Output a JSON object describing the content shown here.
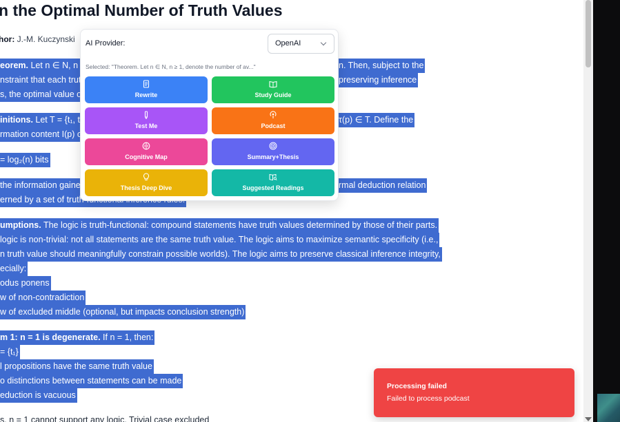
{
  "document": {
    "title": "n the Optimal Number of Truth Values",
    "author_label": "hor:",
    "author_name": "J.-M. Kuczynski",
    "lines": {
      "l1a": "eorem.",
      "l1b": " Let n ∈ N, n ≥ 1",
      "l1c": "n. Then, subject to the",
      "l2a": "nstraint that each truth",
      "l2b": "preserving inference",
      "l3a": "s, the optimal value of",
      "l4a": "initions.",
      "l4b": " Let T = {t₁, t₂,",
      "l4c": "τ(p) ∈ T. Define the",
      "l5a": "rmation content I(p) o",
      "l6": "= log₂(n) bits",
      "l7a": " the information gaine",
      "l7b": "rmal deduction relation",
      "l8": "erned by a set of truth-functional inference rules.",
      "l9a": "umptions.",
      "l9b": " The logic is truth-functional: compound statements have truth values determined by those of their parts.",
      "l10": " logic is non-trivial: not all statements are the same truth value. The logic aims to maximize semantic specificity (i.e.,",
      "l11": "n truth value should meaningfully constrain possible worlds). The logic aims to preserve classical inference integrity,",
      "l12": "ecially:",
      "l13": "odus ponens",
      "l14": "w of non-contradiction",
      "l15": "w of excluded middle (optional, but impacts conclusion strength)",
      "l16a": "m 1: n = 1 is degenerate.",
      "l16b": " If n = 1, then:",
      "l17": "= {t₁}",
      "l18": "l propositions have the same truth value",
      "l19": "o distinctions between statements can be made",
      "l20": "eduction is vacuous",
      "l21": "s. n = 1 cannot support any logic. Trivial case excluded"
    }
  },
  "popup": {
    "provider_label": "AI Provider:",
    "provider_value": "OpenAI",
    "selected_text": "Selected: \"Theorem. Let n ∈ N, n ≥ 1, denote the number of av...\"",
    "buttons": {
      "rewrite": "Rewrite",
      "study_guide": "Study Guide",
      "test_me": "Test Me",
      "podcast": "Podcast",
      "cognitive_map": "Cognitive Map",
      "summary_thesis": "Summary+Thesis",
      "thesis_deep_dive": "Thesis Deep Dive",
      "suggested_readings": "Suggested Readings"
    },
    "colors": {
      "rewrite": "#3b82f6",
      "study_guide": "#22c55e",
      "test_me": "#a855f7",
      "podcast": "#f97316",
      "cognitive_map": "#ec4899",
      "summary_thesis": "#6366f1",
      "thesis_deep_dive": "#eab308",
      "suggested_readings": "#14b8a6"
    }
  },
  "toast": {
    "title": "Processing failed",
    "message": "Failed to process podcast",
    "color": "#ef4444"
  },
  "highlight_color": "#3f6bd0"
}
